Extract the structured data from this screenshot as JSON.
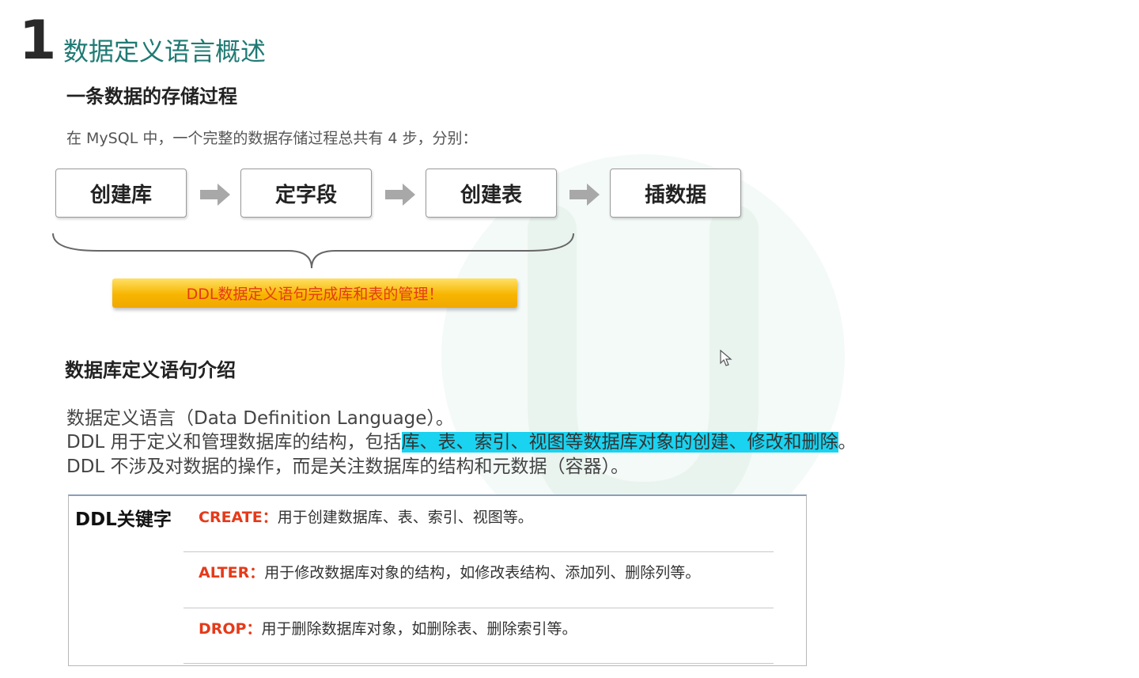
{
  "header": {
    "section_number": "1",
    "title": "数据定义语言概述"
  },
  "storage": {
    "heading": "一条数据的存储过程",
    "intro": "在 MySQL 中，一个完整的数据存储过程总共有 4 步，分别：",
    "steps": [
      "创建库",
      "定字段",
      "创建表",
      "插数据"
    ],
    "banner": "DDL数据定义语句完成库和表的管理！"
  },
  "ddl_intro": {
    "heading": "数据库定义语句介绍",
    "line1": "数据定义语言（Data Definition Language）。",
    "line2_prefix": "DDL 用于定义和管理数据库的结构，包括",
    "line2_highlight": "库、表、索引、视图等数据库对象的创建、修改和删除",
    "line2_suffix": "。",
    "line3": "DDL 不涉及对数据的操作，而是关注数据库的结构和元数据（容器）。"
  },
  "keywords": {
    "heading": "DDL关键字",
    "items": [
      {
        "name": "CREATE：",
        "desc": "用于创建数据库、表、索引、视图等。"
      },
      {
        "name": "ALTER：",
        "desc": "用于修改数据库对象的结构，如修改表结构、添加列、删除列等。"
      },
      {
        "name": "DROP：",
        "desc": "用于删除数据库对象，如删除表、删除索引等。"
      }
    ]
  },
  "colors": {
    "title": "#1f7a73",
    "highlight": "#19d3f0",
    "keyword": "#e53a1a",
    "banner": "#f7b500"
  }
}
